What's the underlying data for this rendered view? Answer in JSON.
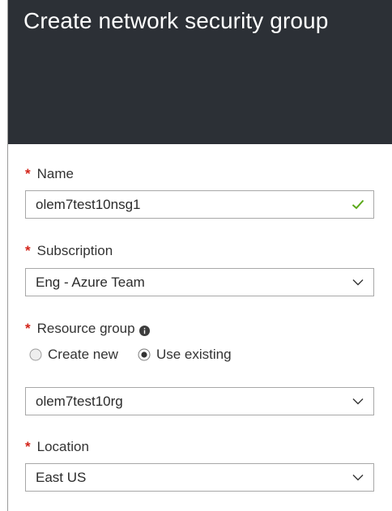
{
  "header": {
    "title": "Create network security group"
  },
  "form": {
    "required_marker": "*",
    "name": {
      "label": "Name",
      "value": "olem7test10nsg1",
      "status_icon": "checkmark-icon"
    },
    "subscription": {
      "label": "Subscription",
      "value": "Eng - Azure Team"
    },
    "resource_group": {
      "label": "Resource group",
      "info_icon": "info-icon",
      "options": [
        {
          "label": "Create new",
          "selected": false
        },
        {
          "label": "Use existing",
          "selected": true
        }
      ],
      "value": "olem7test10rg"
    },
    "location": {
      "label": "Location",
      "value": "East US"
    }
  },
  "colors": {
    "header_bg": "#2c3036",
    "required": "#d3241a",
    "valid_check": "#5ba91a",
    "border": "#a8a8a8"
  }
}
